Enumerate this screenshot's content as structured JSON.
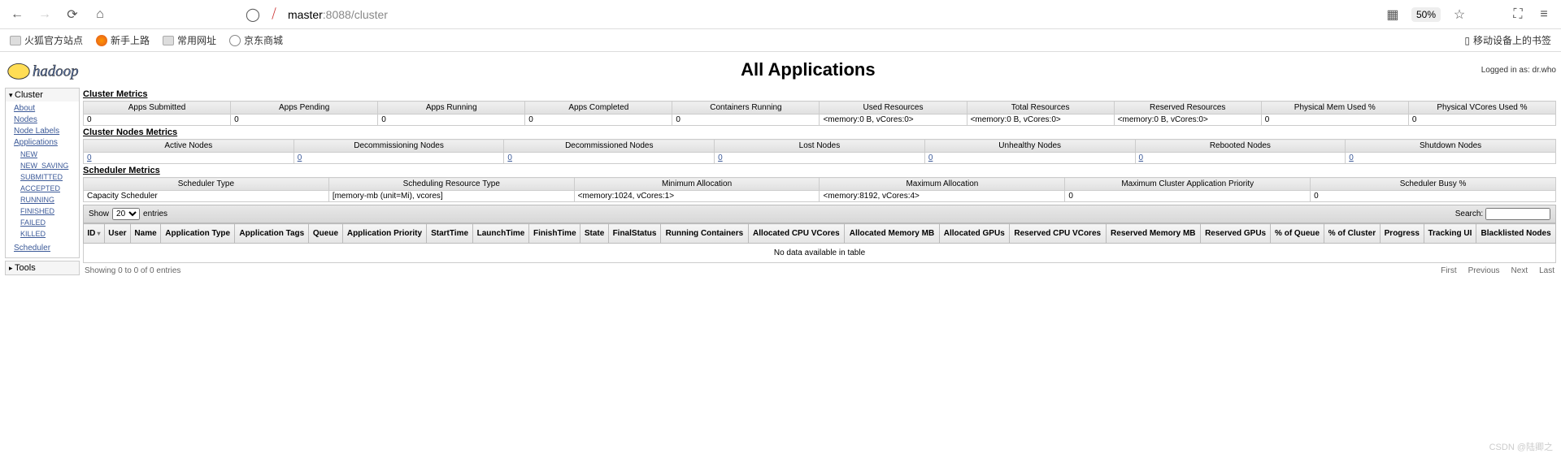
{
  "browser": {
    "url_host": "master",
    "url_port_path": ":8088/cluster",
    "zoom": "50%"
  },
  "bookmarks": {
    "items": [
      "火狐官方站点",
      "新手上路",
      "常用网址",
      "京东商城"
    ],
    "right": "移动设备上的书签"
  },
  "header": {
    "title": "All Applications",
    "logged_in": "Logged in as: dr.who"
  },
  "sidebar": {
    "cluster": {
      "title": "Cluster",
      "links": [
        "About",
        "Nodes",
        "Node Labels",
        "Applications"
      ],
      "app_states": [
        "NEW",
        "NEW_SAVING",
        "SUBMITTED",
        "ACCEPTED",
        "RUNNING",
        "FINISHED",
        "FAILED",
        "KILLED"
      ],
      "scheduler": "Scheduler"
    },
    "tools": {
      "title": "Tools"
    }
  },
  "cluster_metrics": {
    "title": "Cluster Metrics",
    "headers": [
      "Apps Submitted",
      "Apps Pending",
      "Apps Running",
      "Apps Completed",
      "Containers Running",
      "Used Resources",
      "Total Resources",
      "Reserved Resources",
      "Physical Mem Used %",
      "Physical VCores Used %"
    ],
    "values": [
      "0",
      "0",
      "0",
      "0",
      "0",
      "<memory:0 B, vCores:0>",
      "<memory:0 B, vCores:0>",
      "<memory:0 B, vCores:0>",
      "0",
      "0"
    ]
  },
  "nodes_metrics": {
    "title": "Cluster Nodes Metrics",
    "headers": [
      "Active Nodes",
      "Decommissioning Nodes",
      "Decommissioned Nodes",
      "Lost Nodes",
      "Unhealthy Nodes",
      "Rebooted Nodes",
      "Shutdown Nodes"
    ],
    "values": [
      "0",
      "0",
      "0",
      "0",
      "0",
      "0",
      "0"
    ]
  },
  "scheduler_metrics": {
    "title": "Scheduler Metrics",
    "headers": [
      "Scheduler Type",
      "Scheduling Resource Type",
      "Minimum Allocation",
      "Maximum Allocation",
      "Maximum Cluster Application Priority",
      "Scheduler Busy %"
    ],
    "values": [
      "Capacity Scheduler",
      "[memory-mb (unit=Mi), vcores]",
      "<memory:1024, vCores:1>",
      "<memory:8192, vCores:4>",
      "0",
      "0"
    ]
  },
  "apps": {
    "show_label": "Show",
    "entries_label": "entries",
    "page_size": "20",
    "search_label": "Search:",
    "columns": [
      "ID",
      "User",
      "Name",
      "Application Type",
      "Application Tags",
      "Queue",
      "Application Priority",
      "StartTime",
      "LaunchTime",
      "FinishTime",
      "State",
      "FinalStatus",
      "Running Containers",
      "Allocated CPU VCores",
      "Allocated Memory MB",
      "Allocated GPUs",
      "Reserved CPU VCores",
      "Reserved Memory MB",
      "Reserved GPUs",
      "% of Queue",
      "% of Cluster",
      "Progress",
      "Tracking UI",
      "Blacklisted Nodes"
    ],
    "no_data": "No data available in table",
    "info": "Showing 0 to 0 of 0 entries",
    "pager": [
      "First",
      "Previous",
      "Next",
      "Last"
    ]
  },
  "watermark": "CSDN @陆卿之"
}
